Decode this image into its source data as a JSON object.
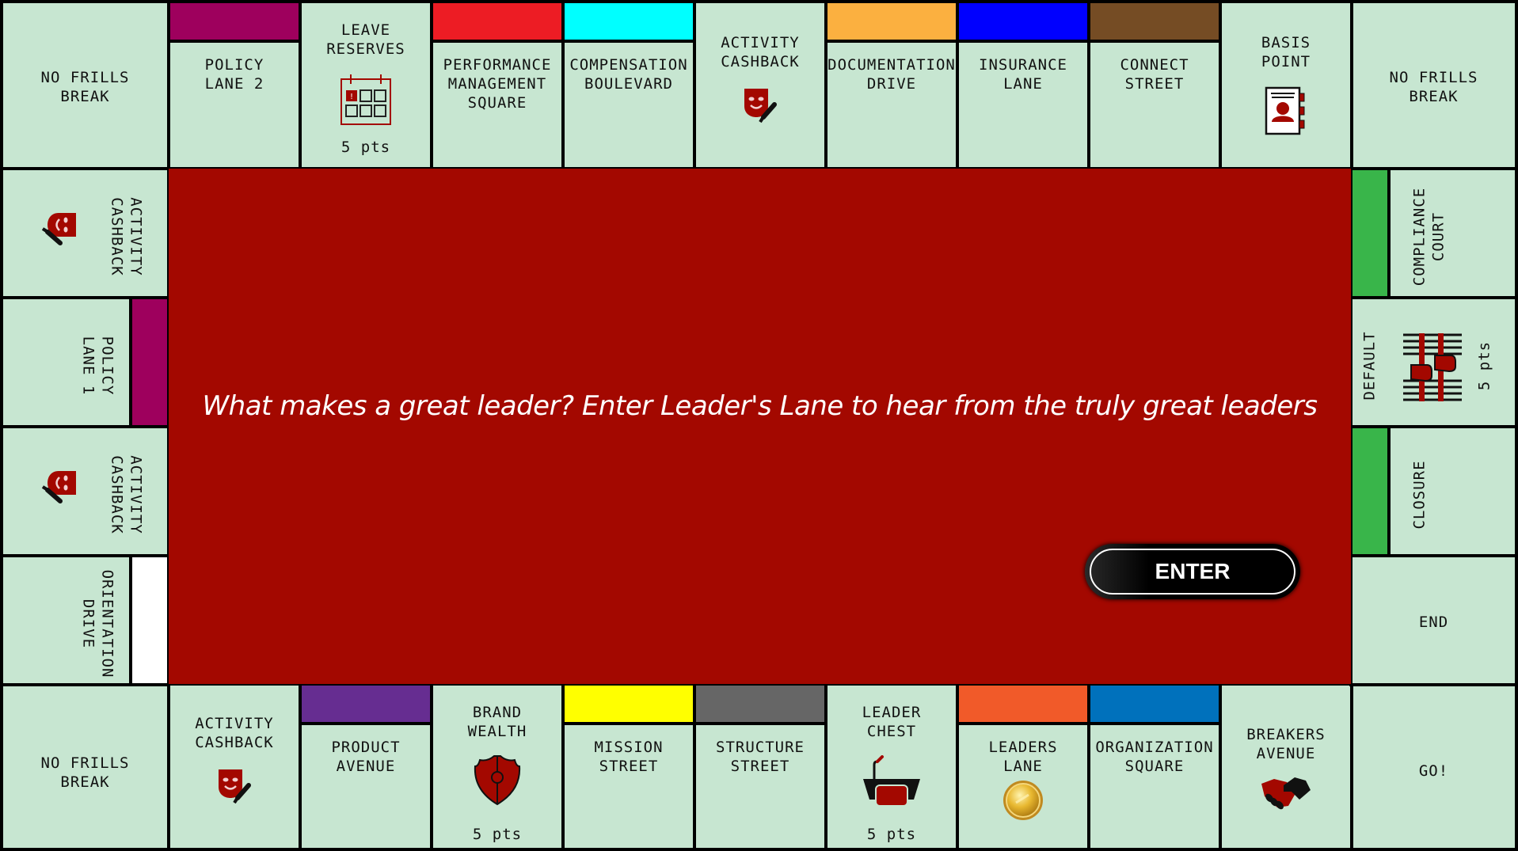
{
  "board": {
    "colors": {
      "cell_bg": "#c7e6d1",
      "center_bg": "#a30800",
      "icon_red": "#a30800"
    },
    "corners": {
      "top_left": "NO FRILLS\nBREAK",
      "top_right": "NO FRILLS\nBREAK",
      "bottom_left": "NO FRILLS\nBREAK",
      "bottom_right": "GO!"
    },
    "top_row": [
      {
        "label": "POLICY\nLANE 2",
        "color": "#9e005d"
      },
      {
        "label": "LEAVE\nRESERVES",
        "icon": "calendar-icon",
        "points": "5 pts"
      },
      {
        "label": "PERFORMANCE\nMANAGEMENT\nSQUARE",
        "color": "#ed1c24"
      },
      {
        "label": "COMPENSATION\nBOULEVARD",
        "color": "#00ffff"
      },
      {
        "label": "ACTIVITY\nCASHBACK",
        "icon": "theater-mask-icon"
      },
      {
        "label": "DOCUMENTATION\nDRIVE",
        "color": "#fbb040"
      },
      {
        "label": "INSURANCE\nLANE",
        "color": "#0000ff"
      },
      {
        "label": "CONNECT\nSTREET",
        "color": "#754c24"
      },
      {
        "label": "BASIS\nPOINT",
        "icon": "address-book-icon"
      }
    ],
    "left_column": [
      {
        "label": "ACTIVITY\nCASHBACK",
        "icon": "theater-mask-icon"
      },
      {
        "label": "POLICY\nLANE 1",
        "color": "#9e005d"
      },
      {
        "label": "ACTIVITY\nCASHBACK",
        "icon": "theater-mask-icon"
      },
      {
        "label": "ORIENTATION\nDRIVE",
        "color": "#ffffff"
      }
    ],
    "right_column": [
      {
        "label": "COMPLIANCE\nCOURT",
        "color": "#39b54a"
      },
      {
        "label": "DEFAULT",
        "icon": "jail-icon",
        "points": "5 pts"
      },
      {
        "label": "CLOSURE",
        "color": "#39b54a"
      },
      {
        "label": "END"
      }
    ],
    "bottom_row": [
      {
        "label": "ACTIVITY\nCASHBACK",
        "icon": "theater-mask-icon"
      },
      {
        "label": "PRODUCT\nAVENUE",
        "color": "#662d91"
      },
      {
        "label": "BRAND\nWEALTH",
        "icon": "shield-icon",
        "points": "5 pts"
      },
      {
        "label": "MISSION\nSTREET",
        "color": "#ffff00"
      },
      {
        "label": "STRUCTURE\nSTREET",
        "color": "#666666"
      },
      {
        "label": "LEADER\nCHEST",
        "icon": "podium-icon",
        "points": "5 pts"
      },
      {
        "label": "LEADERS\nLANE",
        "color": "#f15a29",
        "icon": "gold-coin-icon"
      },
      {
        "label": "ORGANIZATION\nSQUARE",
        "color": "#0071bc"
      },
      {
        "label": "BREAKERS\nAVENUE",
        "icon": "handshake-icon"
      }
    ]
  },
  "center": {
    "message": "What makes a great leader? Enter Leader's Lane to hear from the truly great leaders",
    "enter_label": "ENTER"
  }
}
